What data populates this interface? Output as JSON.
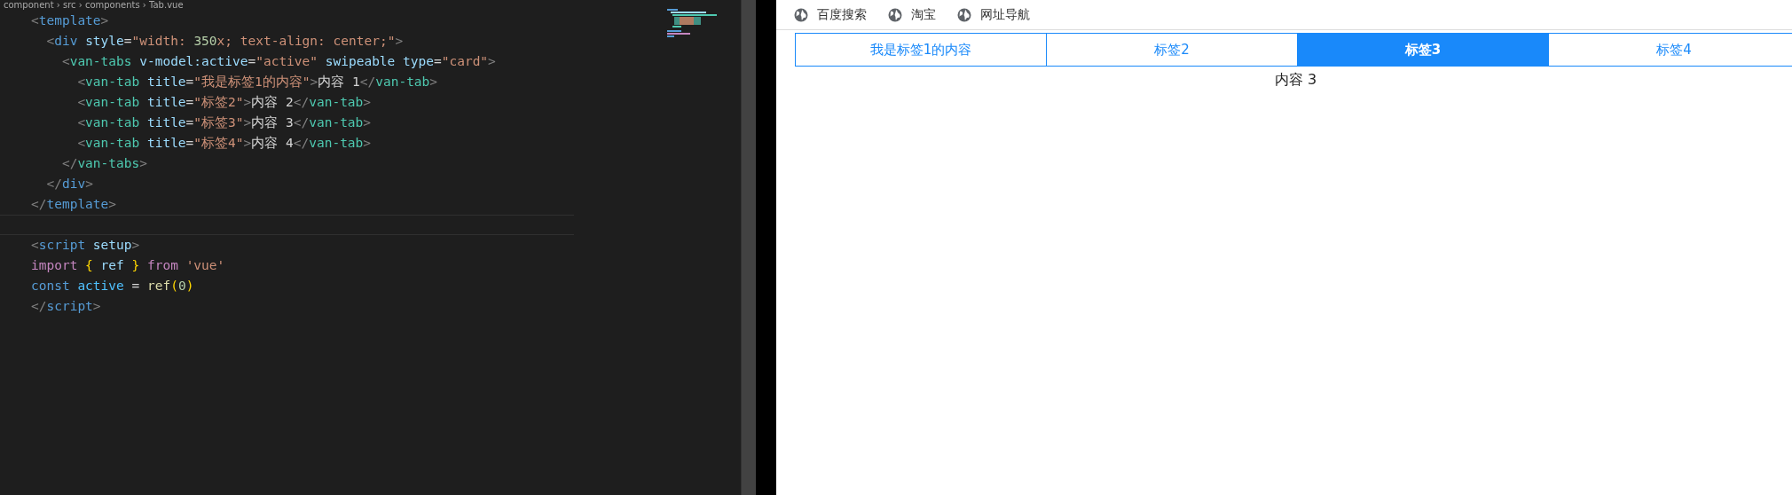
{
  "editor": {
    "breadcrumb": "component › src › components › Tab.vue",
    "lines": [
      {
        "tokens": [
          {
            "t": "<",
            "kind": "punct"
          },
          {
            "t": "template",
            "kind": "tag"
          },
          {
            "t": ">",
            "kind": "punct"
          }
        ]
      },
      {
        "tokens": [
          {
            "t": "  <",
            "kind": "punct"
          },
          {
            "t": "div",
            "kind": "tag"
          },
          {
            "t": " style",
            "kind": "attr"
          },
          {
            "t": "=",
            "kind": "text"
          },
          {
            "t": "\"width: ",
            "kind": "str"
          },
          {
            "t": "350",
            "kind": "num"
          },
          {
            "t": "x; text-align: center;\"",
            "kind": "str"
          },
          {
            "t": ">",
            "kind": "punct"
          }
        ]
      },
      {
        "tokens": [
          {
            "t": "    <",
            "kind": "punct"
          },
          {
            "t": "van-tabs",
            "kind": "comp"
          },
          {
            "t": " v-model:active",
            "kind": "attr"
          },
          {
            "t": "=",
            "kind": "text"
          },
          {
            "t": "\"active\"",
            "kind": "str"
          },
          {
            "t": " swipeable type",
            "kind": "attr"
          },
          {
            "t": "=",
            "kind": "text"
          },
          {
            "t": "\"card\"",
            "kind": "str"
          },
          {
            "t": ">",
            "kind": "punct"
          }
        ]
      },
      {
        "tokens": [
          {
            "t": "      <",
            "kind": "punct"
          },
          {
            "t": "van-tab",
            "kind": "comp"
          },
          {
            "t": " title",
            "kind": "attr"
          },
          {
            "t": "=",
            "kind": "text"
          },
          {
            "t": "\"我是标签1的内容\"",
            "kind": "str"
          },
          {
            "t": ">",
            "kind": "punct"
          },
          {
            "t": "内容 1",
            "kind": "text"
          },
          {
            "t": "</",
            "kind": "punct"
          },
          {
            "t": "van-tab",
            "kind": "comp"
          },
          {
            "t": ">",
            "kind": "punct"
          }
        ]
      },
      {
        "tokens": [
          {
            "t": "      <",
            "kind": "punct"
          },
          {
            "t": "van-tab",
            "kind": "comp"
          },
          {
            "t": " title",
            "kind": "attr"
          },
          {
            "t": "=",
            "kind": "text"
          },
          {
            "t": "\"标签2\"",
            "kind": "str"
          },
          {
            "t": ">",
            "kind": "punct"
          },
          {
            "t": "内容 2",
            "kind": "text"
          },
          {
            "t": "</",
            "kind": "punct"
          },
          {
            "t": "van-tab",
            "kind": "comp"
          },
          {
            "t": ">",
            "kind": "punct"
          }
        ]
      },
      {
        "tokens": [
          {
            "t": "      <",
            "kind": "punct"
          },
          {
            "t": "van-tab",
            "kind": "comp"
          },
          {
            "t": " title",
            "kind": "attr"
          },
          {
            "t": "=",
            "kind": "text"
          },
          {
            "t": "\"标签3\"",
            "kind": "str"
          },
          {
            "t": ">",
            "kind": "punct"
          },
          {
            "t": "内容 3",
            "kind": "text"
          },
          {
            "t": "</",
            "kind": "punct"
          },
          {
            "t": "van-tab",
            "kind": "comp"
          },
          {
            "t": ">",
            "kind": "punct"
          }
        ]
      },
      {
        "tokens": [
          {
            "t": "      <",
            "kind": "punct"
          },
          {
            "t": "van-tab",
            "kind": "comp"
          },
          {
            "t": " title",
            "kind": "attr"
          },
          {
            "t": "=",
            "kind": "text"
          },
          {
            "t": "\"标签4\"",
            "kind": "str"
          },
          {
            "t": ">",
            "kind": "punct"
          },
          {
            "t": "内容 4",
            "kind": "text"
          },
          {
            "t": "</",
            "kind": "punct"
          },
          {
            "t": "van-tab",
            "kind": "comp"
          },
          {
            "t": ">",
            "kind": "punct"
          }
        ]
      },
      {
        "tokens": [
          {
            "t": "    </",
            "kind": "punct"
          },
          {
            "t": "van-tabs",
            "kind": "comp"
          },
          {
            "t": ">",
            "kind": "punct"
          }
        ]
      },
      {
        "tokens": [
          {
            "t": "  </",
            "kind": "punct"
          },
          {
            "t": "div",
            "kind": "tag"
          },
          {
            "t": ">",
            "kind": "punct"
          }
        ]
      },
      {
        "tokens": [
          {
            "t": "</",
            "kind": "punct"
          },
          {
            "t": "template",
            "kind": "tag"
          },
          {
            "t": ">",
            "kind": "punct"
          }
        ]
      },
      {
        "current": true
      },
      {
        "tokens": [
          {
            "t": "<",
            "kind": "punct"
          },
          {
            "t": "script",
            "kind": "tag"
          },
          {
            "t": " setup",
            "kind": "attr"
          },
          {
            "t": ">",
            "kind": "punct"
          }
        ]
      },
      {
        "tokens": [
          {
            "t": "import",
            "kind": "keyword"
          },
          {
            "t": " {",
            "kind": "brace"
          },
          {
            "t": " ref ",
            "kind": "attr"
          },
          {
            "t": "}",
            "kind": "brace"
          },
          {
            "t": " from",
            "kind": "keyword"
          },
          {
            "t": " 'vue'",
            "kind": "str"
          }
        ]
      },
      {
        "tokens": [
          {
            "t": "const",
            "kind": "tag"
          },
          {
            "t": " active",
            "kind": "var"
          },
          {
            "t": " = ",
            "kind": "text"
          },
          {
            "t": "ref",
            "kind": "func"
          },
          {
            "t": "(",
            "kind": "brace"
          },
          {
            "t": "0",
            "kind": "num"
          },
          {
            "t": ")",
            "kind": "brace"
          }
        ]
      },
      {
        "tokens": [
          {
            "t": "</",
            "kind": "punct"
          },
          {
            "t": "script",
            "kind": "tag"
          },
          {
            "t": ">",
            "kind": "punct"
          }
        ]
      }
    ]
  },
  "browser": {
    "bookmarks": [
      "百度搜索",
      "淘宝",
      "网址导航"
    ],
    "tabs": [
      {
        "label": "我是标签1的内容",
        "selected": false
      },
      {
        "label": "标签2",
        "selected": false
      },
      {
        "label": "标签3",
        "selected": true
      },
      {
        "label": "标签4",
        "selected": false
      }
    ],
    "content": "内容 3"
  }
}
